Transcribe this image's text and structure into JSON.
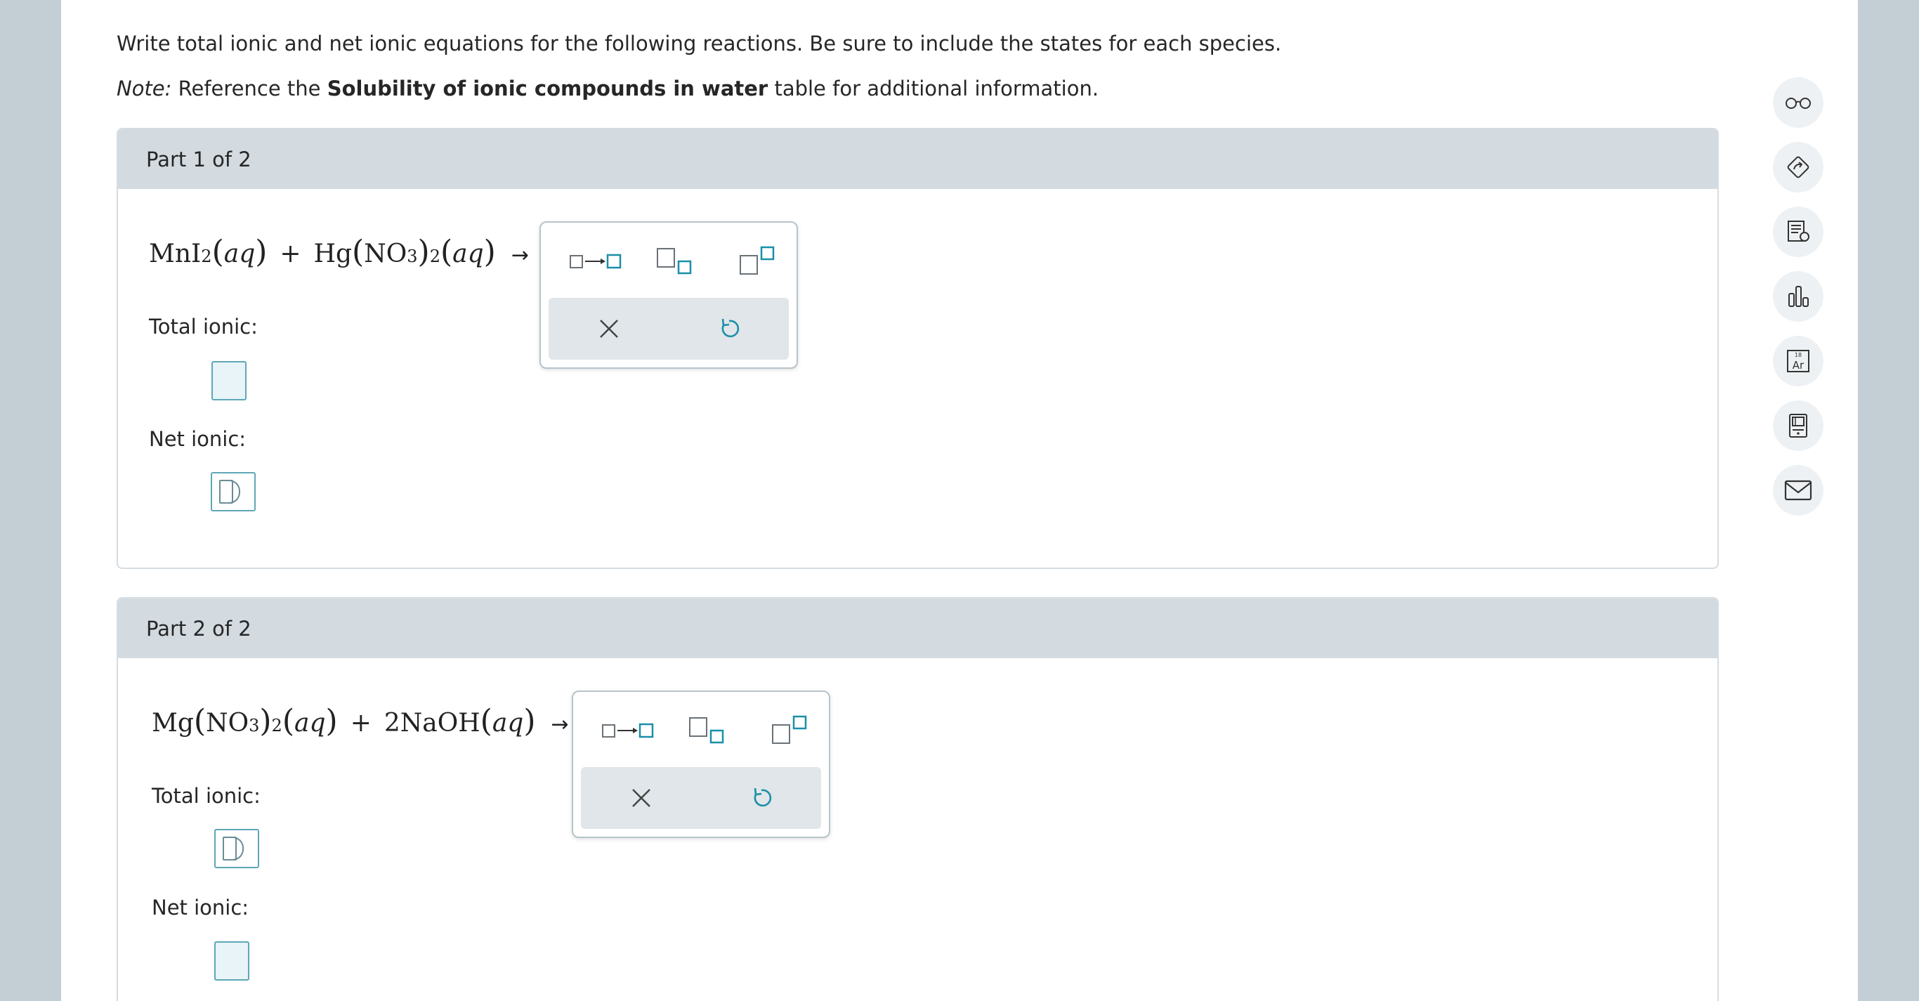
{
  "prompt": "Write total ionic and net ionic equations for the following reactions. Be sure to include the states for each species.",
  "note": {
    "label": "Note:",
    "pre": "Reference the",
    "bold": "Solubility of ionic compounds in water",
    "post": "table for additional information."
  },
  "part1": {
    "header": "Part 1 of 2",
    "reactant1": "MnI",
    "reactant1_sub": "2",
    "state": "aq",
    "plus": "+",
    "reactant2_prefix": "Hg",
    "no3": "NO",
    "no3_sub": "3",
    "outer_sub": "2",
    "arrow": "→",
    "total_label": "Total ionic:",
    "net_label": "Net ionic:"
  },
  "part2": {
    "header": "Part 2 of 2",
    "reactant1_prefix": "Mg",
    "no3": "NO",
    "no3_sub": "3",
    "outer_sub": "2",
    "state": "aq",
    "plus": "+",
    "reactant2": "2NaOH",
    "arrow": "→",
    "total_label": "Total ionic:",
    "net_label": "Net ionic:"
  },
  "palette": {
    "reaction_arrow_tool": "reaction-arrow",
    "subscript_tool": "subscript",
    "superscript_tool": "superscript",
    "clear_tool": "×",
    "undo_tool": "undo"
  },
  "sidebar": {
    "icons": [
      "glasses-icon",
      "tag-icon",
      "explanation-icon",
      "chart-icon",
      "periodic-table-icon",
      "calculator-icon",
      "mail-icon"
    ],
    "periodic_number": "18",
    "periodic_symbol": "Ar"
  },
  "colors": {
    "accent": "#1a8fa8",
    "header_bg": "#d3dbe1",
    "page_bg": "#c3cfd5"
  }
}
